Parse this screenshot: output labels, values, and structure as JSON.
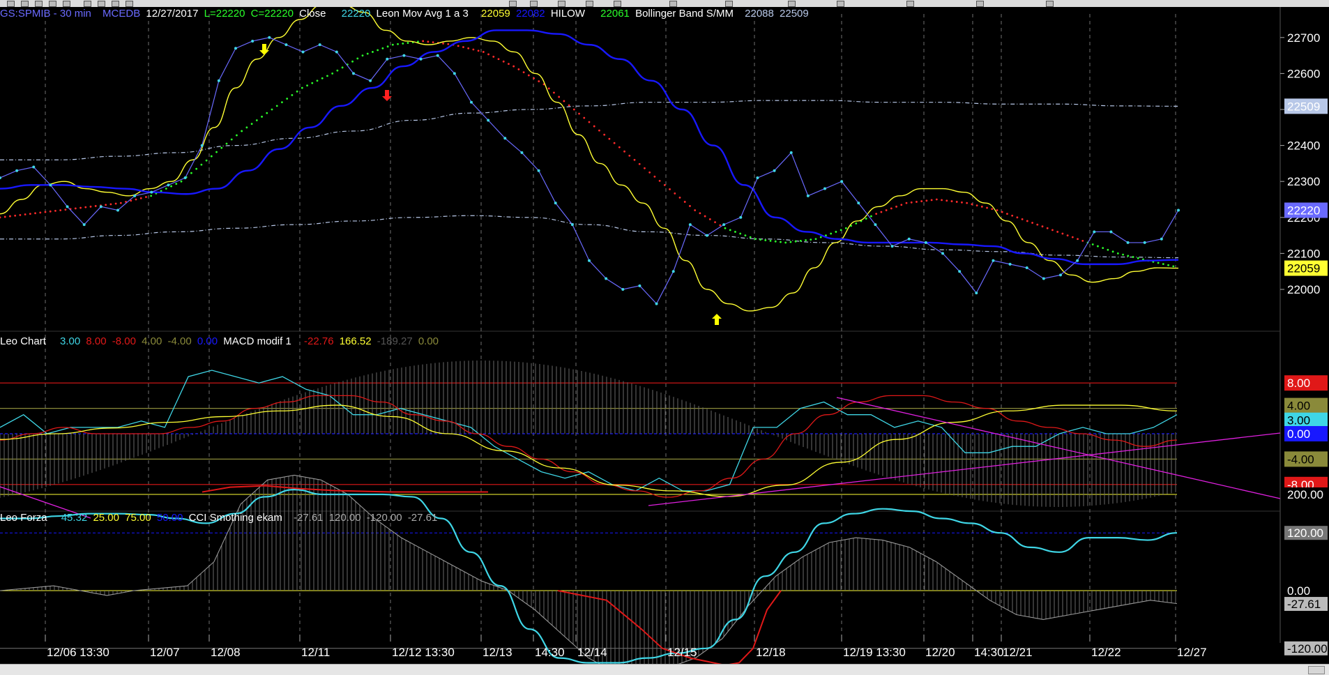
{
  "panel1": {
    "symbol": "GS:SPMIB - 30 min",
    "source": "MCEDB",
    "date": "12/27/2017",
    "low": "L=22220",
    "close_short": "C=22220",
    "close_label": "Close",
    "close_value": "22220",
    "mov_avg_label": "Leon Mov Avg 1 a 3",
    "mov_avg_value1": "22059",
    "mov_avg_value2": "22082",
    "hilow_label": "HILOW",
    "hilow_value": "22061",
    "bollinger_label": "Bollinger Band S/MM",
    "bollinger_value1": "22088",
    "bollinger_value2": "22509"
  },
  "panel2": {
    "name": "Leo Chart",
    "v1": "3.00",
    "v2": "8.00",
    "v3": "-8.00",
    "v4": "4.00",
    "v5": "-4.00",
    "v6": "0.00",
    "macd_label": "MACD modif 1",
    "macd_v1": "-22.76",
    "macd_v2": "166.52",
    "macd_v3": "-189.27",
    "macd_v4": "0.00"
  },
  "panel3": {
    "name": "Leo Forza",
    "v1": "45.32",
    "v2": "25.00",
    "v3": "75.00",
    "v4": "50.00",
    "cci_label": "CCI Smothing ekam",
    "cci_v1": "-27.61",
    "cci_v2": "120.00",
    "cci_v3": "-120.00",
    "cci_v4": "-27.61"
  },
  "colors": {
    "background": "#000000",
    "close": "#3fd6e6",
    "close_line": "#6a6aff",
    "mov_avg": "#ffff33",
    "mov_avg2": "#1818ff",
    "red_dots": "#ff2a2a",
    "green_dots": "#2aff2a",
    "bollinger": "#b8c8e8",
    "magenta": "#e020e0",
    "osc_red": "#e01818",
    "grid": "#707070"
  },
  "chart_data": [
    {
      "type": "line",
      "panel": "price",
      "x_tick_labels": [
        "12/06 13:30",
        "12/07",
        "12/08",
        "12/11",
        "12/12 13:30",
        "12/13",
        "14:30",
        "12/14",
        "12/15",
        "12/18",
        "12/19 13:30",
        "12/20",
        "14:30",
        "12/21",
        "12/22",
        "12/27"
      ],
      "y_tick_labels": [
        "22700",
        "22600",
        "22500",
        "22400",
        "22300",
        "22200",
        "22100",
        "22000"
      ],
      "ylim": [
        21950,
        22760
      ],
      "price_badges": [
        {
          "value": "22509",
          "color": "#b8c8e8"
        },
        {
          "value": "22220",
          "color": "#6a6aff"
        },
        {
          "value": "22059",
          "color": "#ffff33"
        }
      ],
      "series": [
        {
          "name": "Close",
          "values": [
            22310,
            22330,
            22340,
            22290,
            22230,
            22180,
            22230,
            22220,
            22260,
            22270,
            22290,
            22310,
            22400,
            22580,
            22670,
            22690,
            22700,
            22680,
            22660,
            22680,
            22660,
            22600,
            22580,
            22640,
            22650,
            22640,
            22650,
            22600,
            22520,
            22470,
            22420,
            22380,
            22330,
            22240,
            22180,
            22080,
            22030,
            22000,
            22010,
            21960,
            22050,
            22180,
            22150,
            22180,
            22200,
            22310,
            22330,
            22380,
            22260,
            22280,
            22300,
            22240,
            22180,
            22120,
            22140,
            22130,
            22100,
            22050,
            21990,
            22080,
            22070,
            22060,
            22030,
            22040,
            22080,
            22160,
            22160,
            22130,
            22130,
            22140,
            22220
          ]
        },
        {
          "name": "Leon Mov Avg 1 a 3",
          "values": [
            22210,
            22250,
            22290,
            22300,
            22280,
            22270,
            22260,
            22280,
            22300,
            22360,
            22450,
            22560,
            22640,
            22700,
            22750,
            22790,
            22790,
            22770,
            22720,
            22690,
            22680,
            22690,
            22700,
            22690,
            22660,
            22600,
            22520,
            22430,
            22350,
            22290,
            22240,
            22170,
            22080,
            22000,
            21960,
            21940,
            21950,
            21990,
            22060,
            22130,
            22190,
            22230,
            22260,
            22280,
            22280,
            22270,
            22240,
            22190,
            22130,
            22080,
            22040,
            22020,
            22030,
            22050,
            22060,
            22059
          ]
        },
        {
          "name": "22082",
          "values": [
            22280,
            22290,
            22290,
            22285,
            22280,
            22270,
            22265,
            22280,
            22330,
            22390,
            22450,
            22510,
            22560,
            22620,
            22660,
            22690,
            22720,
            22720,
            22710,
            22680,
            22640,
            22580,
            22500,
            22400,
            22290,
            22200,
            22160,
            22140,
            22130,
            22130,
            22130,
            22125,
            22120,
            22100,
            22085,
            22070,
            22070,
            22080,
            22082
          ]
        },
        {
          "name": "HILOW",
          "values": [
            22200,
            22210,
            22220,
            22230,
            22240,
            22260,
            22300,
            22370,
            22440,
            22500,
            22560,
            22600,
            22650,
            22680,
            22690,
            22680,
            22660,
            22620,
            22570,
            22500,
            22430,
            22360,
            22290,
            22220,
            22170,
            22140,
            22130,
            22140,
            22170,
            22210,
            22240,
            22250,
            22240,
            22220,
            22190,
            22160,
            22130,
            22100,
            22080,
            22061
          ]
        }
      ]
    },
    {
      "type": "line",
      "panel": "leo-chart",
      "y_tick_labels": [
        "8.00",
        "4.00",
        "3.00",
        "0.00",
        "-4.00",
        "-8.00"
      ],
      "ylim": [
        -10,
        11
      ],
      "levels": [
        8,
        4,
        0,
        -4,
        -8
      ]
    },
    {
      "type": "line",
      "panel": "leo-forza",
      "y_tick_labels": [
        "200.00",
        "120.00",
        "0.00",
        "-27.61",
        "-120.00"
      ],
      "levels": [
        200,
        120,
        0,
        -120
      ]
    }
  ]
}
